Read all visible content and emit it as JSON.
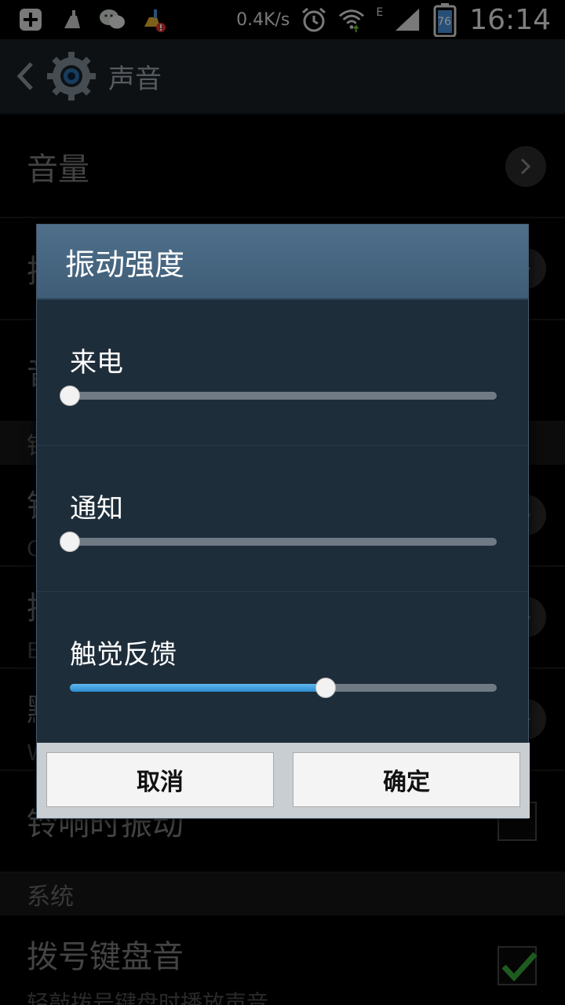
{
  "status_bar": {
    "net_speed": "0.4K/s",
    "network_type": "E",
    "battery": "76",
    "time": "16:14",
    "icons": [
      "add-icon",
      "cleaner-icon",
      "wechat-icon",
      "broom-alert-icon",
      "alarm-icon",
      "wifi-icon",
      "signal-icon",
      "battery-icon"
    ]
  },
  "action_bar": {
    "title": "声音",
    "icon": "settings-gear-icon"
  },
  "background_list": {
    "row1_title": "音量",
    "row2_title": "振",
    "row3_title": "音",
    "section1": "铃",
    "row4_title": "铃",
    "row4_sub": "C",
    "row5_title": "拨",
    "row5_sub": "E",
    "row6_title": "默",
    "row6_sub": "W",
    "row7_title": "铃响时振动",
    "section2": "系统",
    "row8_title": "拨号键盘音",
    "row8_sub": "轻敲拨号键盘时播放声音"
  },
  "dialog": {
    "title": "振动强度",
    "sliders": [
      {
        "label": "来电",
        "value": 0.0
      },
      {
        "label": "通知",
        "value": 0.0
      },
      {
        "label": "触觉反馈",
        "value": 0.6
      }
    ],
    "cancel_label": "取消",
    "ok_label": "确定"
  },
  "colors": {
    "accent": "#2d8cd0",
    "dialog_header": "#4a6a85",
    "check_green": "#3aa53a"
  }
}
